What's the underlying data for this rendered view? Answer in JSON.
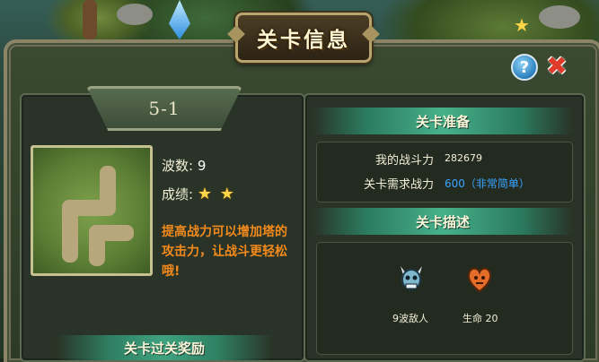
{
  "dialog": {
    "title": "关卡信息",
    "help_label": "?",
    "close_label": "✖"
  },
  "level": {
    "name": "5-1",
    "waves_label": "波数:",
    "waves_value": "9",
    "grade_label": "成绩:",
    "stars": 2,
    "star_char": "★",
    "tip": "提高战力可以增加塔的攻击力，让战斗更轻松哦!",
    "reward_header": "关卡过关奖励"
  },
  "preparation": {
    "header": "关卡准备",
    "my_power_label": "我的战斗力",
    "my_power_value": "282679",
    "required_power_label": "关卡需求战力",
    "required_power_value": "600（非常简单）"
  },
  "description": {
    "header": "关卡描述",
    "enemies_label": "9波敌人",
    "lives_label": "生命  20",
    "enemy_icon": "horned-skull-icon",
    "lives_icon": "heart-demon-icon"
  },
  "colors": {
    "accent_green": "#47b18b",
    "tip_orange": "#f28a1c",
    "required_blue": "#39a6ff",
    "star_gold": "#ffd54a"
  }
}
